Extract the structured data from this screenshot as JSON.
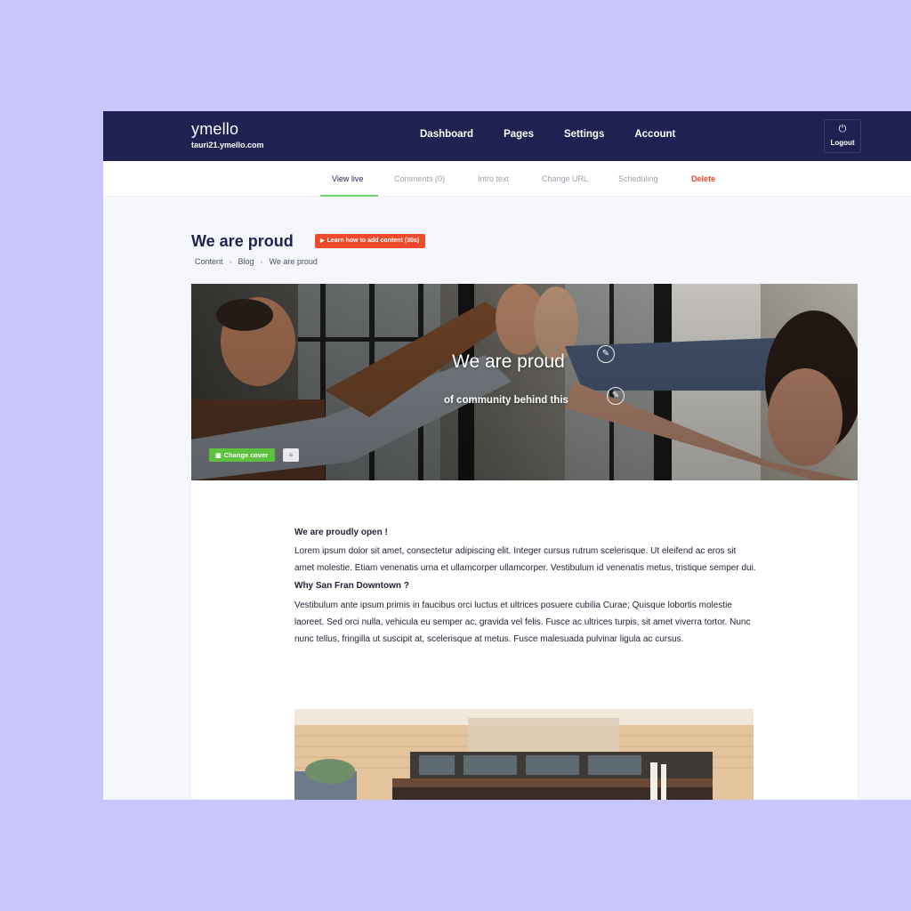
{
  "brand": {
    "logo": "ymello",
    "url": "tauri21.ymello.com"
  },
  "nav": {
    "items": [
      "Dashboard",
      "Pages",
      "Settings",
      "Account"
    ]
  },
  "logout": {
    "icon": "logout-icon",
    "label": "Logout"
  },
  "subnav": {
    "tabs": [
      {
        "label": "View live",
        "active": true
      },
      {
        "label": "Comments (0)"
      },
      {
        "label": "Intro text"
      },
      {
        "label": "Change URL"
      },
      {
        "label": "Scheduling"
      },
      {
        "label": "Delete",
        "danger": true
      }
    ]
  },
  "page": {
    "title": "We are proud",
    "help_button": "Learn how to add content (30s)",
    "breadcrumb": [
      "Content",
      "Blog",
      "We are proud"
    ]
  },
  "cover": {
    "title": "We are proud",
    "subtitle": "of community behind this",
    "change_cover": "Change cover",
    "menu_icon": "menu-icon"
  },
  "article": {
    "heading1": "We are proudly open !",
    "paragraph1": "Lorem ipsum dolor sit amet, consectetur adipiscing elit. Integer cursus rutrum scelerisque. Ut eleifend ac eros sit amet molestie. Etiam venenatis urna et ullamcorper ullamcorper. Vestibulum id venenatis metus, tristique semper dui.",
    "heading2": "Why San Fran Downtown ?",
    "paragraph2": "Vestibulum ante ipsum primis in faucibus orci luctus et ultrices posuere cubilia Curae; Quisque lobortis molestie laoreet. Sed orci nulla, vehicula eu semper ac, gravida vel felis. Fusce ac ultrices turpis, sit amet viverra tortor. Nunc nunc tellus, fringilla ut suscipit at, scelerisque at metus. Fusce malesuada pulvinar ligula ac cursus."
  },
  "colors": {
    "background": "#c8c6fd",
    "topbar": "#1f2251",
    "accent_green": "#6cd36f",
    "danger_red": "#ef4627"
  }
}
